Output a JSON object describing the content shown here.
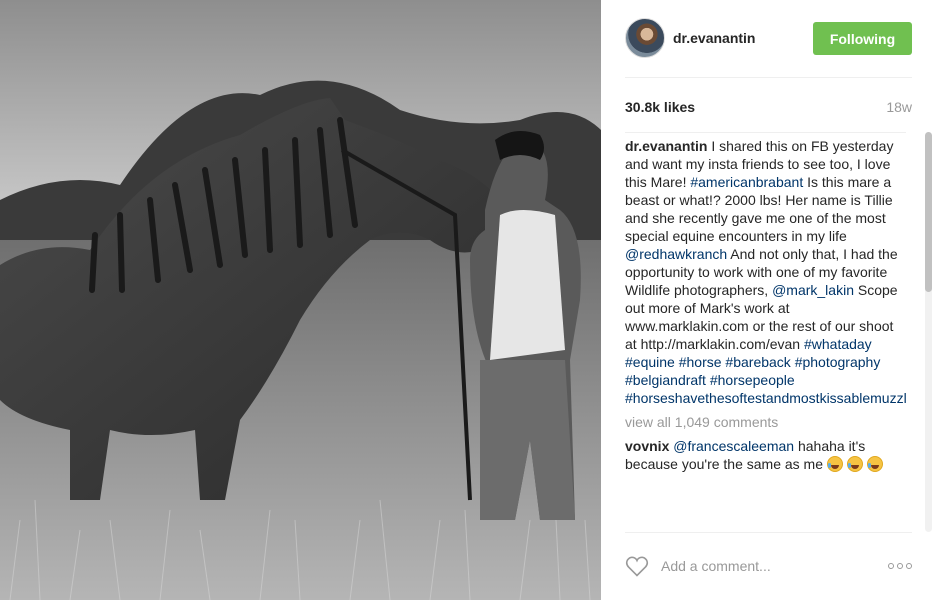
{
  "post": {
    "photo_alt": "horse-photo",
    "username": "dr.evanantin",
    "follow_label": "Following",
    "likes": "30.8k likes",
    "time": "18w"
  },
  "caption": {
    "username": "dr.evanantin",
    "parts": [
      " I shared this on FB yesterday and want my insta friends to see too, I love this Mare! ",
      "#americanbrabant",
      " Is this mare a beast or what!? 2000 lbs! Her name is Tillie and she recently gave me one of the most special equine encounters in my life ",
      "@redhawkranch",
      " And not only that, I had the opportunity to work with one of my favorite Wildlife photographers, ",
      "@mark_lakin",
      " Scope out more of Mark's work at www.marklakin.com or the rest of our shoot at http://marklakin.com/evan ",
      "#whataday",
      " ",
      "#equine",
      " ",
      "#horse",
      " ",
      "#bareback",
      " ",
      "#photography",
      " ",
      "#belgiandraft",
      " ",
      "#horsepeople",
      " ",
      "#horseshavethesoftestandmostkissablemuzzlesever"
    ]
  },
  "view_all": "view all 1,049 comments",
  "comment": {
    "username": "vovnix",
    "mention": "@francescaleeman",
    "text": " hahaha it's because you're the same as me"
  },
  "footer": {
    "add_comment_placeholder": "Add a comment..."
  },
  "colors": {
    "follow": "#70c050",
    "link": "#003569"
  }
}
